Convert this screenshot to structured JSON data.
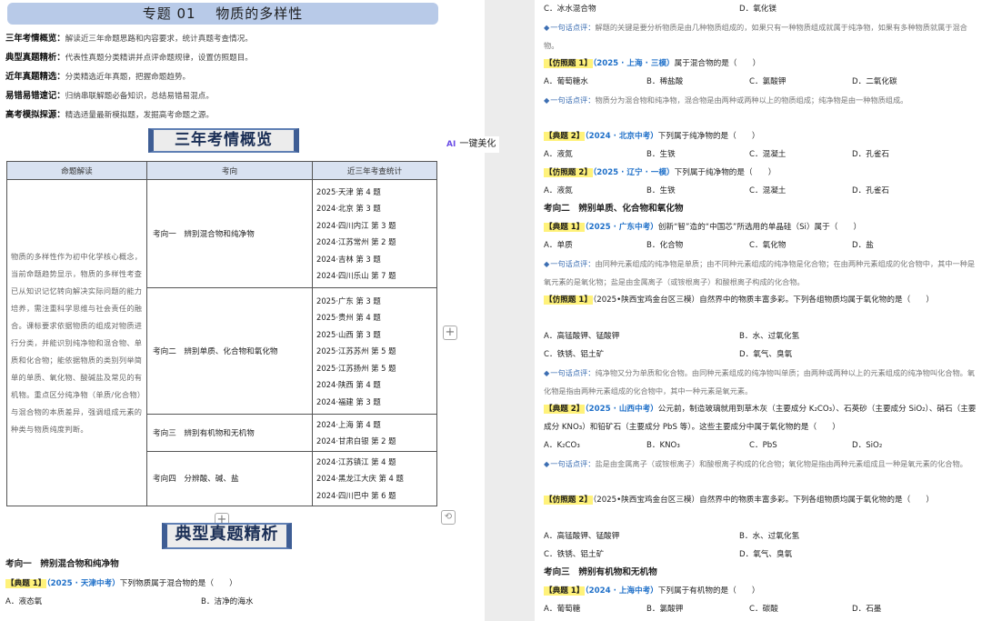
{
  "left": {
    "title": "专题 01　 物质的多样性",
    "overview": [
      {
        "key": "三年考情概览：",
        "val": "解读近三年命题思路和内容要求，统计真题考查情况。"
      },
      {
        "key": "典型真题精析：",
        "val": "代表性真题分类精讲并点评命题规律，设置仿照题目。"
      },
      {
        "key": "近年真题精选：",
        "val": "分类精选近年真题，把握命题趋势。"
      },
      {
        "key": "易错易错速记：",
        "val": "归纳串联解题必备知识，总结易错易混点。"
      },
      {
        "key": "高考模拟探源：",
        "val": "精选适量最新模拟题，发掘高考命题之源。"
      }
    ],
    "badge_overview": "三年考情概览",
    "table": {
      "headers": [
        "命题解读",
        "考向",
        "近三年考查统计"
      ],
      "interpretation": "物质的多样性作为初中化学核心概念，当前命题趋势显示，物质的多样性考查已从知识记忆转向解决实际问题的能力培养，需注重科学思维与社会责任的融合。课标要求依据物质的组成对物质进行分类，并能识别纯净物和混合物、单质和化合物；能依据物质的类别列举简单的单质、氧化物、酸碱盐及常见的有机物。重点区分纯净物（单质/化合物）与混合物的本质差异，强调组成元素的种类与物质纯度判断。",
      "rows": [
        {
          "topic": "考向一　辨别混合物和纯净物",
          "years": [
            "2025·天津 第 4 题",
            "2024·北京 第 3 题",
            "2024·四川内江 第 3 题",
            "2024·江苏常州 第 2 题",
            "2024·吉林 第 3 题",
            "2024·四川乐山 第 7 题"
          ]
        },
        {
          "topic": "考向二　辨别单质、化合物和氧化物",
          "years": [
            "2025·广东 第 3 题",
            "2025·贵州 第 4 题",
            "2025·山西 第 3 题",
            "2025·江苏苏州 第 5 题",
            "2025·江苏扬州 第 5 题",
            "2024·陕西 第 4 题",
            "2024·福建 第 3 题"
          ]
        },
        {
          "topic": "考向三　辨别有机物和无机物",
          "years": [
            "2024·上海 第 4 题",
            "2024·甘肃白银 第 2 题"
          ]
        },
        {
          "topic": "考向四　分辨酸、碱、盐",
          "years": [
            "2024·江苏镇江 第 4 题",
            "2024·黑龙江大庆 第 4 题",
            "2024·四川巴中 第 6 题"
          ]
        }
      ]
    },
    "badge_typical": "典型真题精析",
    "direction1": "考向一　辨别混合物和纯净物",
    "q1": {
      "tag": "【典题 1】",
      "src": "（2025 · 天津中考）",
      "text": "下列物质属于混合物的是（　　）"
    },
    "q1_opts": [
      "A．液态氧",
      "B．洁净的海水"
    ]
  },
  "ui": {
    "ai_label": "一键美化",
    "ai_mark": "AI",
    "plus": "+",
    "refresh": "⟲"
  },
  "right": {
    "top_opts": [
      "C．冰水混合物",
      "D．氧化镁"
    ],
    "c1": {
      "tag": "一句话点评：",
      "text": "解题的关键是要分析物质是由几种物质组成的，如果只有一种物质组成就属于纯净物，如果有多种物质就属于混合物。"
    },
    "f1": {
      "tag": "【仿照题 1】",
      "src": "（2025 · 上海 · 三模）",
      "text": "属于混合物的是（　　）"
    },
    "f1_opts": [
      "A．葡萄糖水",
      "B．稀盐酸",
      "C．氯酸钾",
      "D．二氧化碳"
    ],
    "c2": {
      "tag": "一句话点评：",
      "text": "物质分为混合物和纯净物，混合物是由两种或两种以上的物质组成；纯净物是由一种物质组成。"
    },
    "q2": {
      "tag": "【典题 2】",
      "src": "（2024 · 北京中考）",
      "text": "下列属于纯净物的是（　　）"
    },
    "q2_opts": [
      "A．液氮",
      "B．生铁",
      "C．混凝土",
      "D．孔雀石"
    ],
    "f2": {
      "tag": "【仿照题 2】",
      "src": "（2025 · 辽宁 · 一模）",
      "text": "下列属于纯净物的是（　　）"
    },
    "f2_opts": [
      "A．液氮",
      "B．生铁",
      "C．混凝土",
      "D．孔雀石"
    ],
    "direction2": "考向二　辨别单质、化合物和氧化物",
    "q3": {
      "tag": "【典题 1】",
      "src": "（2025 · 广东中考）",
      "text": "创新“智”造的“中国芯”所选用的单晶硅（Si）属于（　　）"
    },
    "q3_opts": [
      "A．单质",
      "B．化合物",
      "C．氧化物",
      "D．盐"
    ],
    "c3": {
      "tag": "一句话点评：",
      "text": "由同种元素组成的纯净物是单质；由不同种元素组成的纯净物是化合物；在由两种元素组成的化合物中，其中一种是氧元素的是氧化物；盐是由金属离子（或铵根离子）和酸根离子构成的化合物。"
    },
    "f3": {
      "tag": "【仿照题 1】",
      "text": "（2025•陕西宝鸡金台区三模）自然界中的物质丰富多彩。下列各组物质均属于氧化物的是（　　）"
    },
    "f3_opts": [
      "A．高锰酸钾、锰酸钾",
      "B．水、过氧化氢",
      "C．铁锈、铝土矿",
      "D．氧气、臭氧"
    ],
    "c4": {
      "tag": "一句话点评：",
      "text": "纯净物又分为单质和化合物。由同种元素组成的纯净物叫单质；由两种或两种以上的元素组成的纯净物叫化合物。氧化物是指由两种元素组成的化合物中，其中一种元素是氧元素。"
    },
    "q4": {
      "tag": "【典题 2】",
      "src": "（2025 · 山西中考）",
      "text": "公元前，制造玻璃就用到草木灰（主要成分 K₂CO₃）、石英砂（主要成分 SiO₂）、硝石（主要成分 KNO₃）和铅矿石（主要成分 PbS 等）。这些主要成分中属于氧化物的是（　　）"
    },
    "q4_opts": [
      "A．K₂CO₃",
      "B．KNO₃",
      "C．PbS",
      "D．SiO₂"
    ],
    "c5": {
      "tag": "一句话点评：",
      "text": "盐是由金属离子（或铵根离子）和酸根离子构成的化合物；氧化物是指由两种元素组成且一种是氧元素的化合物。"
    },
    "f4": {
      "tag": "【仿照题 2】",
      "text": "（2025•陕西宝鸡金台区三模）自然界中的物质丰富多彩。下列各组物质均属于氧化物的是（　　）"
    },
    "f4_opts": [
      "A．高锰酸钾、锰酸钾",
      "B．水、过氧化氢",
      "C．铁锈、铝土矿",
      "D．氧气、臭氧"
    ],
    "direction3": "考向三　辨别有机物和无机物",
    "q5": {
      "tag": "【典题 1】",
      "src": "（2024 · 上海中考）",
      "text": "下列属于有机物的是（　　）"
    },
    "q5_opts": [
      "A．葡萄糖",
      "B．氯酸钾",
      "C．碳酸",
      "D．石墨"
    ]
  }
}
